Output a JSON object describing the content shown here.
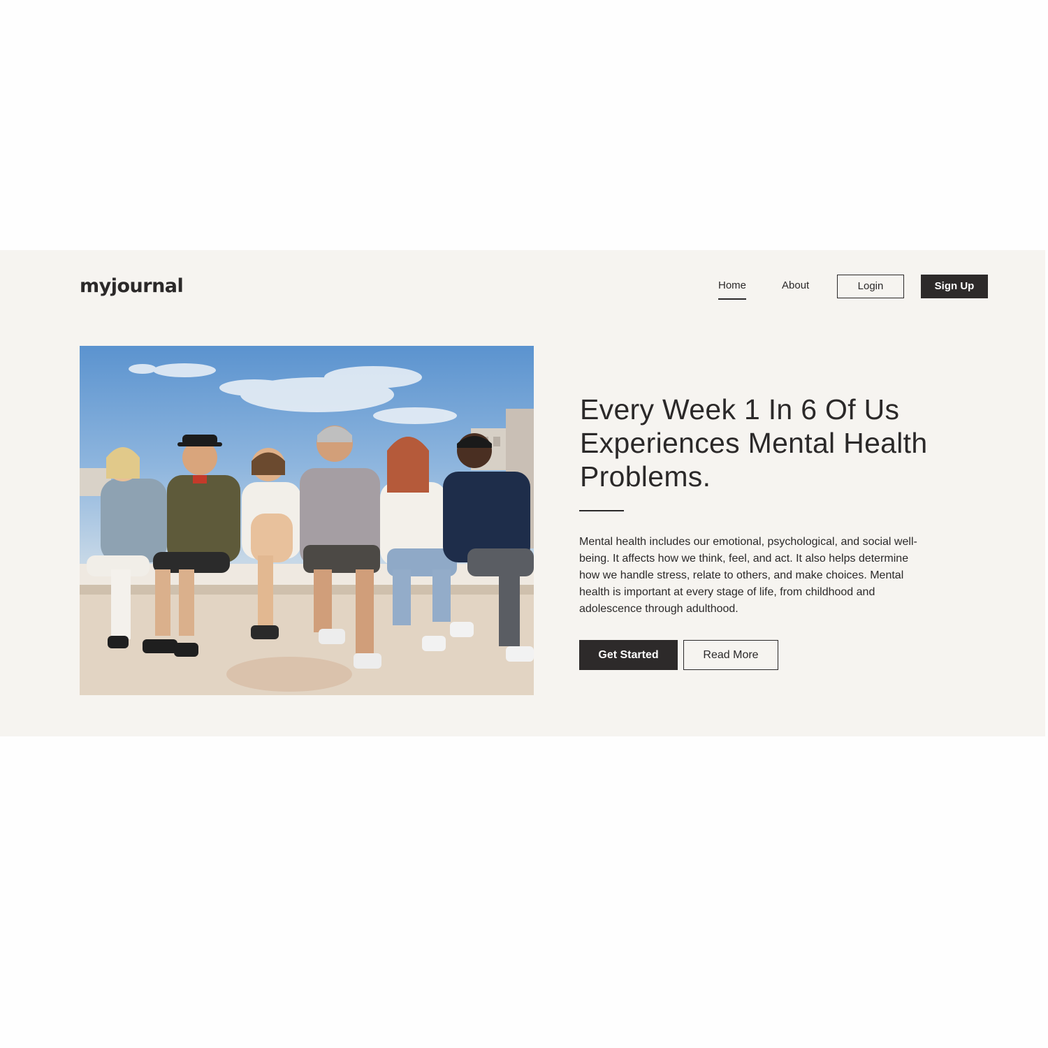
{
  "brand": {
    "logo_text": "myjournal"
  },
  "nav": {
    "home_label": "Home",
    "about_label": "About",
    "login_label": "Login",
    "signup_label": "Sign Up",
    "active": "Home"
  },
  "hero": {
    "image_alt": "Group of six smiling friends sitting on a rooftop ledge under a blue sky",
    "title": "Every Week 1 In 6 Of Us Experiences Mental Health Problems.",
    "body": "Mental health includes our emotional, psychological, and social well-being. It affects how we think, feel, and act. It also helps determine how we handle stress, relate to others, and make choices. Mental health is important at every stage of life, from childhood and adolescence through adulthood.",
    "primary_cta": "Get Started",
    "secondary_cta": "Read More"
  },
  "colors": {
    "hero_background": "#f6f4f0",
    "page_background": "#fefefe",
    "dark": "#2d2a2a",
    "text": "#2b2929"
  }
}
